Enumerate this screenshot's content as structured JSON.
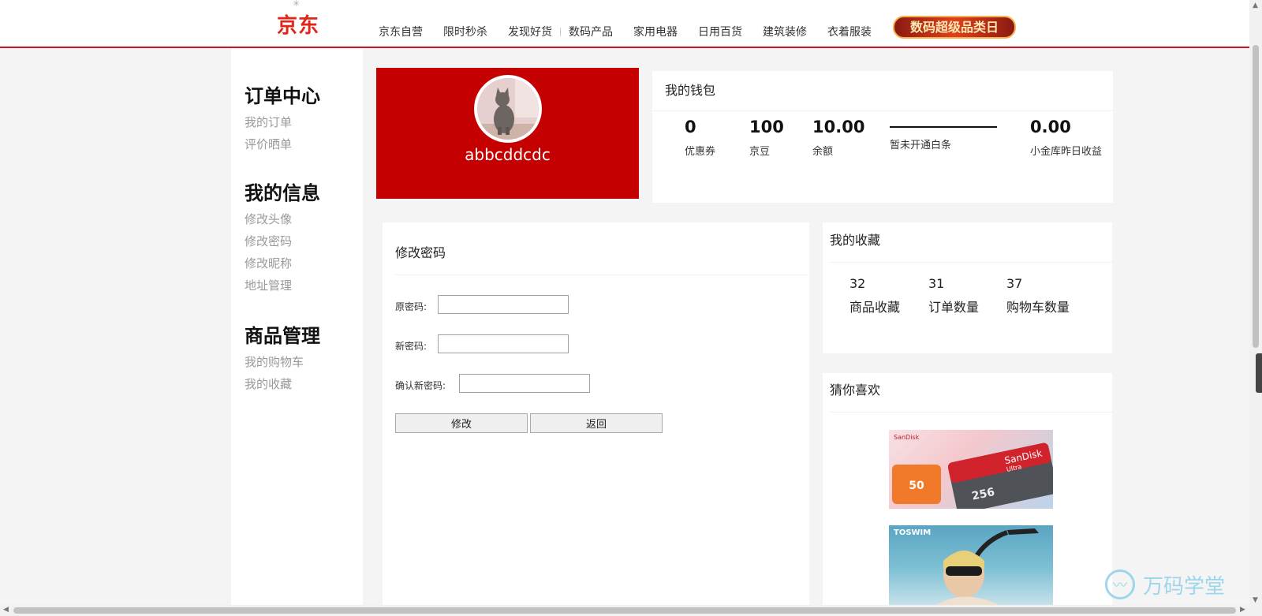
{
  "header": {
    "logo": "京东",
    "nav": [
      "京东自营",
      "限时秒杀",
      "发现好货",
      "数码产品",
      "家用电器",
      "日用百货",
      "建筑装修",
      "衣着服装"
    ],
    "promo": "数码超级品类日"
  },
  "sidebar": {
    "groups": [
      {
        "title": "订单中心",
        "links": [
          "我的订单",
          "评价晒单"
        ]
      },
      {
        "title": "我的信息",
        "links": [
          "修改头像",
          "修改密码",
          "修改昵称",
          "地址管理"
        ]
      },
      {
        "title": "商品管理",
        "links": [
          "我的购物车",
          "我的收藏"
        ]
      }
    ]
  },
  "profile": {
    "username": "abbcddcdc"
  },
  "wallet": {
    "title": "我的钱包",
    "items": [
      {
        "value": "0",
        "label": "优惠券"
      },
      {
        "value": "100",
        "label": "京豆"
      },
      {
        "value": "10.00",
        "label": "余额"
      },
      {
        "value": "",
        "label": "暂未开通白条"
      },
      {
        "value": "0.00",
        "label": "小金库昨日收益"
      }
    ]
  },
  "password_form": {
    "title": "修改密码",
    "old_label": "原密码:",
    "new_label": "新密码:",
    "confirm_label": "确认新密码:",
    "old_value": "",
    "new_value": "",
    "confirm_value": "",
    "submit": "修改",
    "back": "返回"
  },
  "favorites": {
    "title": "我的收藏",
    "items": [
      {
        "value": "32",
        "label": "商品收藏"
      },
      {
        "value": "31",
        "label": "订单数量"
      },
      {
        "value": "37",
        "label": "购物车数量"
      }
    ]
  },
  "recommend": {
    "title": "猜你喜欢",
    "products": [
      {
        "brand": "SanDisk",
        "line": "Ultra",
        "capacity": "256",
        "promo": "50"
      },
      {
        "brand": "TOSWIM"
      }
    ]
  },
  "watermark": {
    "text": "万码学堂"
  },
  "colors": {
    "brand_red": "#c40000",
    "header_line": "#c81623"
  }
}
